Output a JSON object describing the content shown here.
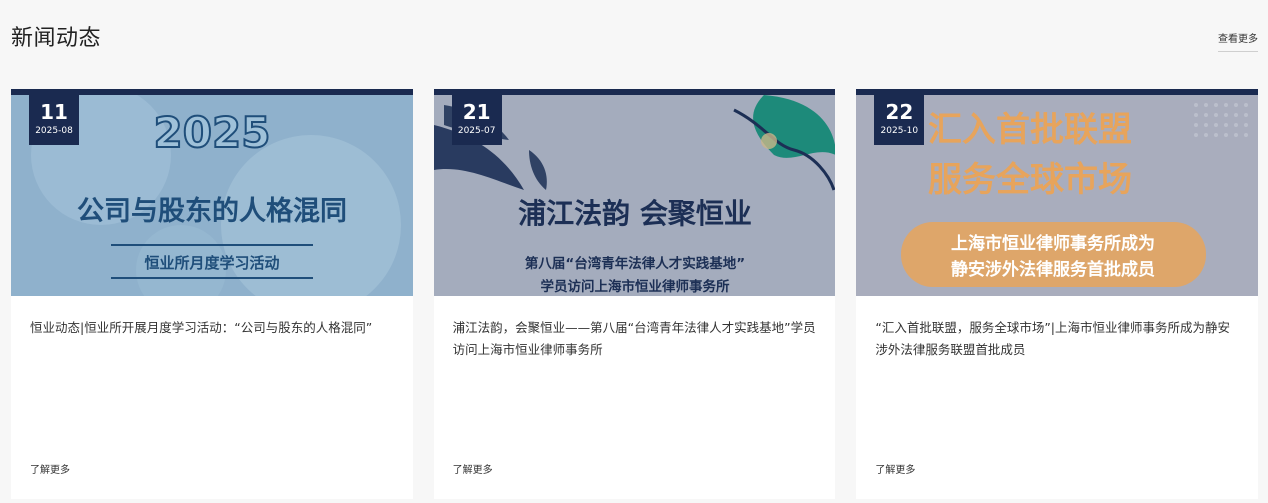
{
  "header": {
    "title": "新闻动态",
    "more_label": "查看更多"
  },
  "cards": [
    {
      "day": "11",
      "year_month": "2025-08",
      "image": {
        "year_text": "2025",
        "headline": "公司与股东的人格混同",
        "subline": "恒业所月度学习活动"
      },
      "title": "恒业动态|恒业所开展月度学习活动：“公司与股东的人格混同”",
      "more_label": "了解更多"
    },
    {
      "day": "21",
      "year_month": "2025-07",
      "image": {
        "headline": "浦江法韵 会聚恒业",
        "subline1": "第八届“台湾青年法律人才实践基地”",
        "subline2": "学员访问上海市恒业律师事务所"
      },
      "title": "浦江法韵，会聚恒业——第八届“台湾青年法律人才实践基地”学员访问上海市恒业律师事务所",
      "more_label": "了解更多"
    },
    {
      "day": "22",
      "year_month": "2025-10",
      "image": {
        "headline1": "汇入首批联盟",
        "headline2": "服务全球市场",
        "subline1": "上海市恒业律师事务所成为",
        "subline2": "静安涉外法律服务首批成员"
      },
      "title": "“汇入首批联盟，服务全球市场”|上海市恒业律师事务所成为静安涉外法律服务联盟首批成员",
      "more_label": "了解更多"
    }
  ],
  "colors": {
    "badge_bg": "#1a2a50",
    "card1_bg": "#8fb1cc",
    "card2_bg": "#a4acbd",
    "card3_bg": "#a9adbd",
    "card3_orange": "#e7a45c"
  }
}
